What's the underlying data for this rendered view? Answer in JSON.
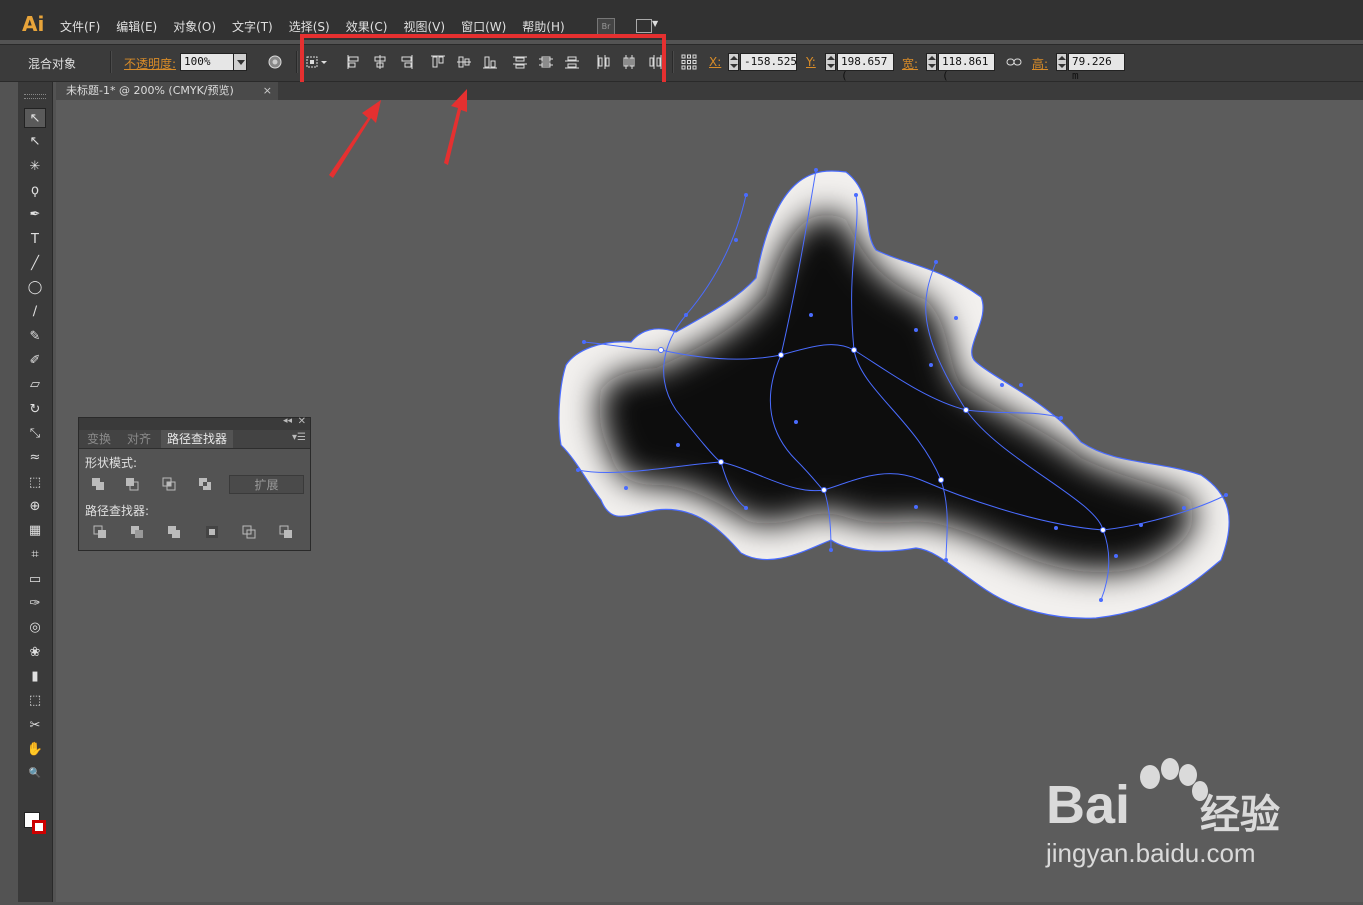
{
  "app": {
    "logo": "Ai"
  },
  "menu": [
    "文件(F)",
    "编辑(E)",
    "对象(O)",
    "文字(T)",
    "选择(S)",
    "效果(C)",
    "视图(V)",
    "窗口(W)",
    "帮助(H)"
  ],
  "bridge_button": "Br",
  "control": {
    "selection_type": "混合对象",
    "opacity_label": "不透明度:",
    "opacity_value": "100%",
    "x_label": "X:",
    "x_value": "-158.525",
    "y_label": "Y:",
    "y_value": "198.657 (",
    "w_label": "宽:",
    "w_value": "118.861 (",
    "h_label": "高:",
    "h_value": "79.226 m"
  },
  "document_tab": {
    "title": "未标题-1* @ 200% (CMYK/预览)",
    "close": "×"
  },
  "pathfinder_panel": {
    "tabs": [
      "变换",
      "对齐",
      "路径查找器"
    ],
    "active_tab": "路径查找器",
    "shape_modes_label": "形状模式:",
    "expand_label": "扩展",
    "pathfinders_label": "路径查找器:"
  },
  "tools": [
    "selection-tool-icon",
    "direct-selection-tool-icon",
    "magic-wand-icon",
    "lasso-icon",
    "pen-tool-icon",
    "type-tool-icon",
    "line-tool-icon",
    "ellipse-tool-icon",
    "paintbrush-icon",
    "pencil-icon",
    "blob-brush-icon",
    "eraser-icon",
    "rotate-icon",
    "scale-icon",
    "warp-icon",
    "free-transform-icon",
    "shape-builder-icon",
    "perspective-grid-icon",
    "mesh-icon",
    "gradient-icon",
    "eyedropper-icon",
    "blend-icon",
    "symbol-sprayer-icon",
    "column-graph-icon",
    "artboard-icon",
    "slice-icon",
    "hand-icon",
    "zoom-icon"
  ],
  "tool_glyphs": [
    "↖",
    "↖",
    "✳",
    "ϙ",
    "✒",
    "T",
    "╱",
    "◯",
    "∕",
    "✎",
    "✐",
    "▱",
    "↻",
    "⤡",
    "≈",
    "⬚",
    "⊕",
    "▦",
    "⌗",
    "▭",
    "✑",
    "◎",
    "❀",
    "▮",
    "⬚",
    "✂",
    "✋",
    "🔍"
  ],
  "watermark": {
    "brand_text": "Bai",
    "brand_cn": "经验",
    "url": "jingyan.baidu.com"
  },
  "colors": {
    "highlight": "#e53030",
    "arrow": "#e53030",
    "path": "#4a6cff",
    "canvas": "#5c5c5c"
  }
}
